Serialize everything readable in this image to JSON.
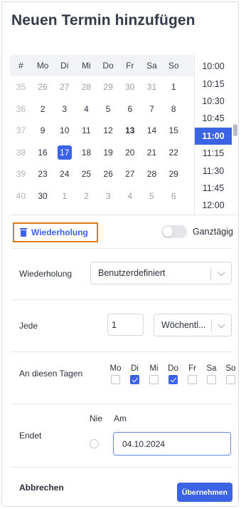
{
  "title": "Neuen Termin hinzufügen",
  "calendar": {
    "headers": [
      "#",
      "Mo",
      "Di",
      "Mi",
      "Do",
      "Fr",
      "Sa",
      "So"
    ],
    "weeks": [
      {
        "wk": "35",
        "days": [
          "26",
          "27",
          "28",
          "29",
          "30",
          "31",
          "1"
        ],
        "dim": [
          true,
          true,
          true,
          true,
          true,
          true,
          false
        ]
      },
      {
        "wk": "36",
        "days": [
          "2",
          "3",
          "4",
          "5",
          "6",
          "7",
          "8"
        ],
        "dim": [
          false,
          false,
          false,
          false,
          false,
          false,
          false
        ]
      },
      {
        "wk": "37",
        "days": [
          "9",
          "10",
          "11",
          "12",
          "13",
          "14",
          "15"
        ],
        "dim": [
          false,
          false,
          false,
          false,
          false,
          false,
          false
        ]
      },
      {
        "wk": "38",
        "days": [
          "16",
          "17",
          "18",
          "19",
          "20",
          "21",
          "22"
        ],
        "dim": [
          false,
          false,
          false,
          false,
          false,
          false,
          false
        ]
      },
      {
        "wk": "39",
        "days": [
          "23",
          "24",
          "25",
          "26",
          "27",
          "28",
          "29"
        ],
        "dim": [
          false,
          false,
          false,
          false,
          false,
          false,
          false
        ]
      },
      {
        "wk": "40",
        "days": [
          "30",
          "1",
          "2",
          "3",
          "4",
          "5",
          "6"
        ],
        "dim": [
          false,
          true,
          true,
          true,
          true,
          true,
          true
        ]
      }
    ],
    "today": "13",
    "selected": "17"
  },
  "times": [
    "10:00",
    "10:15",
    "10:30",
    "10:45",
    "11:00",
    "11:15",
    "11:30",
    "11:45",
    "12:00"
  ],
  "selected_time": "11:00",
  "repeat_button": "Wiederholung",
  "allday_label": "Ganztägig",
  "form": {
    "repeat_label": "Wiederholung",
    "repeat_value": "Benutzerdefiniert",
    "every_label": "Jede",
    "every_value": "1",
    "every_unit": "Wöchentl...",
    "days_label": "An diesen Tagen",
    "weekdays": [
      {
        "label": "Mo",
        "checked": false
      },
      {
        "label": "Di",
        "checked": true
      },
      {
        "label": "Mi",
        "checked": false
      },
      {
        "label": "Do",
        "checked": true
      },
      {
        "label": "Fr",
        "checked": false
      },
      {
        "label": "Sa",
        "checked": false
      },
      {
        "label": "So",
        "checked": false
      }
    ],
    "ends_label": "Endet",
    "never_label": "Nie",
    "on_label": "Am",
    "end_date": "04.10.2024"
  },
  "cancel_label": "Abbrechen",
  "apply_label": "Übernehmen",
  "colors": {
    "accent": "#3b63e6",
    "highlight_border": "#e07b14"
  }
}
